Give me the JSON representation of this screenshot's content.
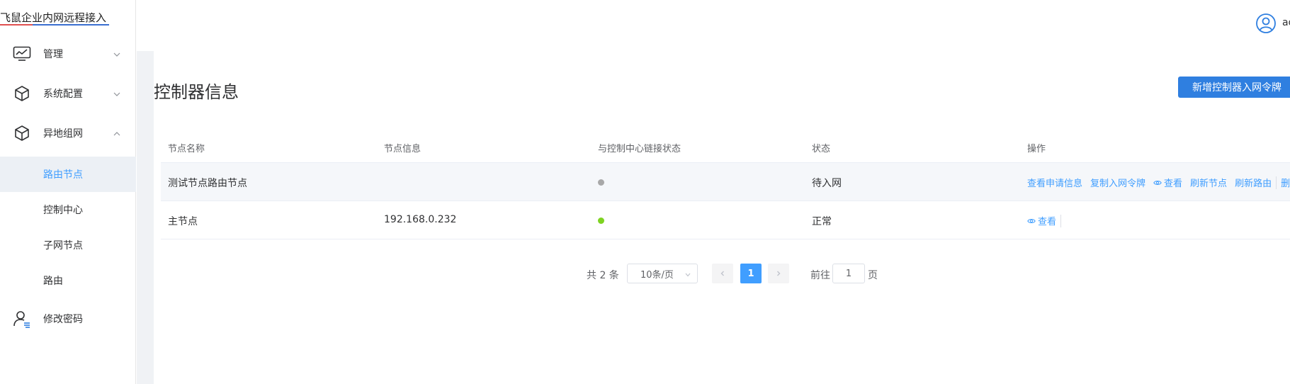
{
  "app": {
    "brand": "飞鼠企业内网远程接入"
  },
  "header": {
    "user_name": "ad"
  },
  "sidebar": {
    "items": [
      {
        "label": "管理",
        "icon": "monitor-chart-icon",
        "expanded": false
      },
      {
        "label": "系统配置",
        "icon": "cube-icon",
        "expanded": false
      },
      {
        "label": "异地组网",
        "icon": "cube-icon",
        "expanded": true
      },
      {
        "label": "修改密码",
        "icon": "user-list-icon"
      }
    ],
    "subitems": [
      {
        "label": "路由节点",
        "active": true
      },
      {
        "label": "控制中心",
        "active": false
      },
      {
        "label": "子网节点",
        "active": false
      },
      {
        "label": "路由",
        "active": false
      }
    ]
  },
  "page": {
    "title": "控制器信息",
    "new_button": "新增控制器入网令牌"
  },
  "table": {
    "headers": [
      "节点名称",
      "节点信息",
      "与控制中心链接状态",
      "状态",
      "操作"
    ],
    "rows": [
      {
        "name": "测试节点路由节点",
        "info": "",
        "link_status": "gray",
        "status": "待入网",
        "actions": [
          "查看申请信息",
          "复制入网令牌",
          "查看",
          "刷新节点",
          "刷新路由",
          "删除"
        ]
      },
      {
        "name": "主节点",
        "info": "192.168.0.232",
        "link_status": "green",
        "status": "正常",
        "actions": [
          "查看"
        ]
      }
    ]
  },
  "pagination": {
    "total": "共 2 条",
    "page_size": "10条/页",
    "current_page": "1",
    "goto_label": "前往",
    "goto_value": "1",
    "page_unit": "页"
  },
  "colors": {
    "accent": "#409eff",
    "button": "#2f7fe0",
    "status_gray": "#a8a8a8",
    "status_green": "#7ed321"
  }
}
